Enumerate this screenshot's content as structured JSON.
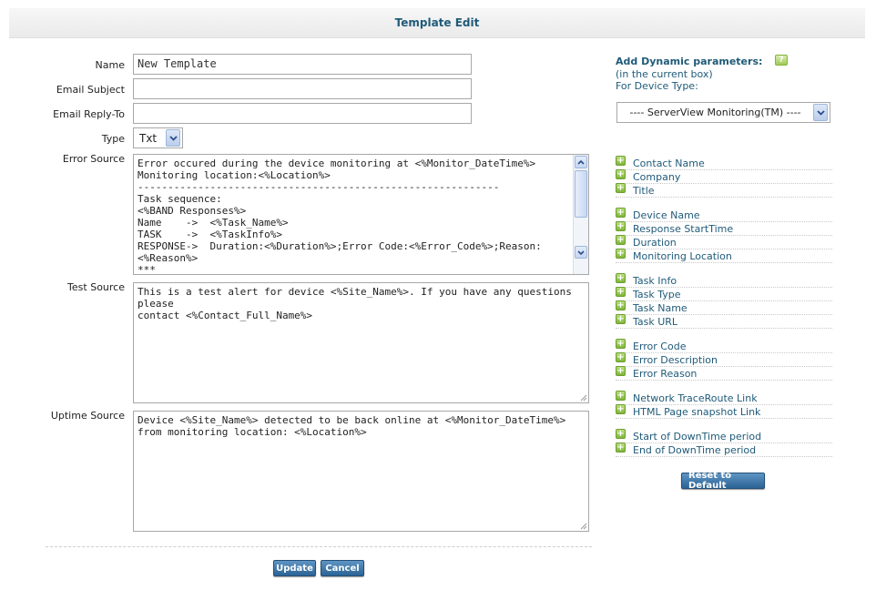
{
  "page": {
    "title": "Template Edit"
  },
  "form": {
    "name_label": "Name",
    "name_value": "New Template",
    "email_subject_label": "Email Subject",
    "email_subject_value": "",
    "reply_to_label": "Email Reply-To",
    "reply_to_value": "",
    "type_label": "Type",
    "type_value": "Txt",
    "error_source_label": "Error Source",
    "error_source_value": "Error occured during the device monitoring at <%Monitor_DateTime%>\nMonitoring location:<%Location%>\n------------------------------------------------------------\nTask sequence:\n<%BAND Responses%>\nName    ->  <%Task_Name%>\nTASK    ->  <%TaskInfo%>\nRESPONSE->  Duration:<%Duration%>;Error Code:<%Error_Code%>;Reason:\n<%Reason%>\n***",
    "test_source_label": "Test Source",
    "test_source_value": "This is a test alert for device <%Site_Name%>. If you have any questions please\ncontact <%Contact_Full_Name%>",
    "uptime_source_label": "Uptime Source",
    "uptime_source_value": "Device <%Site_Name%> detected to be back online at <%Monitor_DateTime%>\nfrom monitoring location: <%Location%>"
  },
  "buttons": {
    "update": "Update",
    "cancel": "Cancel",
    "reset": "Reset to Default"
  },
  "dynamic": {
    "title": "Add Dynamic parameters:",
    "help_icon": "?",
    "subtitle": "(in the current box)",
    "device_type_label": "For Device Type:",
    "device_type_value": "---- ServerView Monitoring(TM) ----",
    "params": [
      "Contact Name",
      "Company",
      "Title",
      "Device Name",
      "Response StartTime",
      "Duration",
      "Monitoring Location",
      "Task Info",
      "Task Type",
      "Task Name",
      "Task URL",
      "Error Code",
      "Error Description",
      "Error Reason",
      "Network TraceRoute Link",
      "HTML Page snapshot Link",
      "Start of DownTime period",
      "End of DownTime period"
    ]
  },
  "icons": {
    "add_param": "plus-icon",
    "help": "help-icon",
    "dropdown": "chevron-down-icon"
  }
}
